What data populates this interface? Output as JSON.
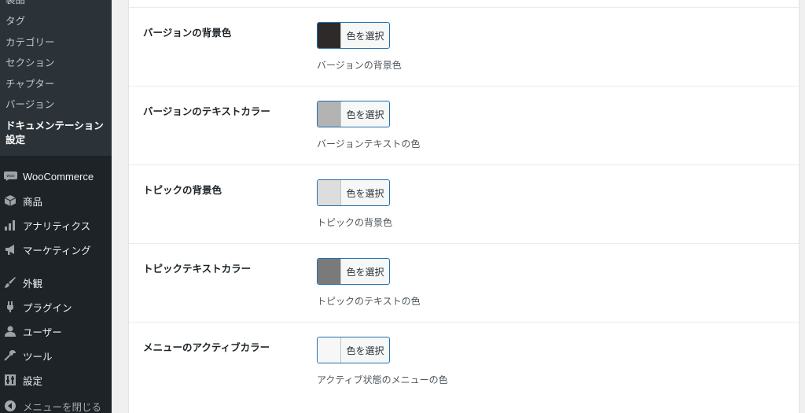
{
  "sidebar": {
    "submenu": [
      {
        "label": "製品"
      },
      {
        "label": "タグ"
      },
      {
        "label": "カテゴリー"
      },
      {
        "label": "セクション"
      },
      {
        "label": "チャプター"
      },
      {
        "label": "バージョン"
      }
    ],
    "current_line1": "ドキュメンテーション",
    "current_line2": "設定",
    "menu": [
      {
        "label": "WooCommerce",
        "icon": "woo-icon"
      },
      {
        "label": "商品",
        "icon": "cube-icon"
      },
      {
        "label": "アナリティクス",
        "icon": "bar-chart-icon"
      },
      {
        "label": "マーケティング",
        "icon": "megaphone-icon"
      },
      {
        "label": "外観",
        "icon": "paintbrush-icon"
      },
      {
        "label": "プラグイン",
        "icon": "plugin-icon"
      },
      {
        "label": "ユーザー",
        "icon": "user-icon"
      },
      {
        "label": "ツール",
        "icon": "wrench-icon"
      },
      {
        "label": "設定",
        "icon": "settings-icon"
      }
    ],
    "collapse_label": "メニューを閉じる"
  },
  "settings": {
    "rows": [
      {
        "label": "バージョンの背景色",
        "button": "色を選択",
        "color": "#2e2a2a",
        "desc": "バージョンの背景色"
      },
      {
        "label": "バージョンのテキストカラー",
        "button": "色を選択",
        "color": "#b3b3b3",
        "desc": "バージョンテキストの色"
      },
      {
        "label": "トピックの背景色",
        "button": "色を選択",
        "color": "#dddddd",
        "desc": "トピックの背景色"
      },
      {
        "label": "トピックテキストカラー",
        "button": "色を選択",
        "color": "#7a7a7a",
        "desc": "トピックのテキストの色"
      },
      {
        "label": "メニューのアクティブカラー",
        "button": "色を選択",
        "color": "#f7f7f7",
        "desc": "アクティブ状態のメニューの色"
      }
    ]
  }
}
